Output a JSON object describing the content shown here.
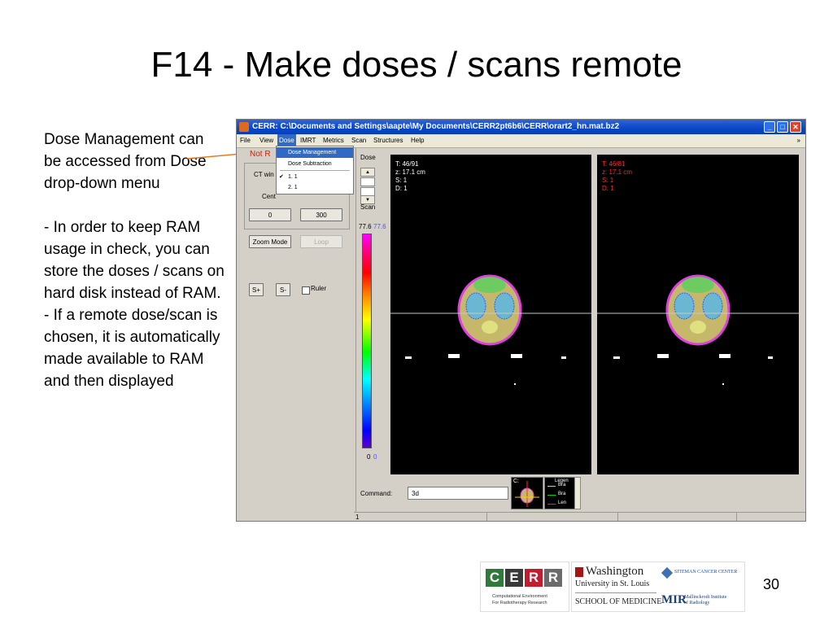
{
  "slide": {
    "title": "F14 - Make doses / scans remote",
    "description_lines": [
      "Dose Management can be accessed from Dose drop-down menu",
      "",
      "- In order to keep RAM usage in check, you can store the doses / scans on hard disk instead of RAM.",
      "- If a remote dose/scan is chosen, it is automatically made available to RAM and then displayed"
    ],
    "page_number": "30"
  },
  "window": {
    "title": "CERR:  C:\\Documents and Settings\\aapte\\My Documents\\CERR2pt6b6\\CERR\\orart2_hn.mat.bz2",
    "menu": [
      "File",
      "View",
      "Dose",
      "IMRT",
      "Metrics",
      "Scan",
      "Structures",
      "Help"
    ],
    "active_menu": "Dose",
    "menu_arrow": "»",
    "controls": {
      "minimize": "_",
      "maximize": "□",
      "close": "✕"
    }
  },
  "dose_menu": {
    "items": [
      "Dose Management",
      "Dose Subtraction"
    ],
    "selected": "Dose Management",
    "doses": [
      {
        "label": "1.  1",
        "checked": true
      },
      {
        "label": "2.  1",
        "checked": false
      }
    ]
  },
  "left_panel": {
    "label_not_ready": "Not R",
    "ct_window_label": "CT win",
    "center_label": "Cent",
    "range_low": "0",
    "range_high": "300",
    "zoom_mode": "Zoom Mode",
    "loop": "Loop",
    "s_plus": "S+",
    "s_minus": "S-",
    "ruler": "Ruler"
  },
  "colorbar": {
    "dose_label": "Dose",
    "scan_label": "Scan",
    "top_left": "77.6",
    "top_right": "77.6",
    "bottom_left": "0",
    "bottom_right": "0",
    "top_right_color": "#4455ff",
    "bottom_right_color": "#4455ff"
  },
  "viewer1": {
    "lines": [
      "T: 46/91",
      "z: 17.1 cm",
      "S: 1",
      "D: 1"
    ],
    "color": "#ffffff"
  },
  "viewer2": {
    "lines": [
      "T: 46/81",
      "z: 17.1 cm",
      "S: 1",
      "D: 1"
    ],
    "color": "#ff2a2a"
  },
  "command": {
    "label": "Command:",
    "value": "3d"
  },
  "thumbnail": {
    "label": "C:"
  },
  "legend": {
    "title": "Legen",
    "items": [
      "Bra",
      "Bra",
      "Len"
    ],
    "colors": [
      "#ffd000",
      "#00d000",
      "#ff2020"
    ]
  },
  "status_bar": {
    "cells": [
      "1",
      "",
      "",
      ""
    ]
  },
  "logos": {
    "cerr_letters": [
      "C",
      "E",
      "R",
      "R"
    ],
    "cerr_colors": [
      "#2f7a3a",
      "#3a3a3a",
      "#c21d2f",
      "#6b6b6b"
    ],
    "cerr_caption_1": "Computational Environment",
    "cerr_caption_2": "For Radiotherapy Research",
    "wustl_1": "Washington",
    "wustl_2": "University in St. Louis",
    "wustl_3": "SCHOOL OF MEDICINE",
    "siteman": "SITEMAN CANCER CENTER",
    "mir": "MIR",
    "mir_text_1": "Mallinckrodt Institute",
    "mir_text_2": "of Radiology"
  }
}
